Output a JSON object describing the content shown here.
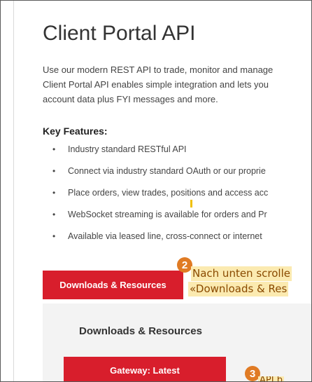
{
  "page": {
    "title": "Client Portal API",
    "intro_lines": [
      "Use our modern REST API to trade, monitor and manage",
      "Client Portal API enables simple integration and lets you",
      "account data plus FYI messages and more."
    ],
    "features_heading": "Key Features:",
    "features": [
      "Industry standard RESTful API",
      "Connect via industry standard OAuth or our proprie",
      "Place orders, view trades, positions and access acc",
      "WebSocket streaming is available for orders and Pr",
      "Available via leased line, cross-connect or internet"
    ],
    "downloads_button": "Downloads & Resources",
    "panel": {
      "title": "Downloads & Resources",
      "gateway_button": "Gateway: Latest"
    }
  },
  "annotations": {
    "step2": {
      "number": "2",
      "line1": "Nach unten scrolle",
      "line2": "«Downloads & Res"
    },
    "step3": {
      "number": "3",
      "text": "API b"
    }
  },
  "colors": {
    "accent_red": "#d81e2c",
    "marker_orange": "#e07b24",
    "callout_bg": "#fbeab0"
  }
}
